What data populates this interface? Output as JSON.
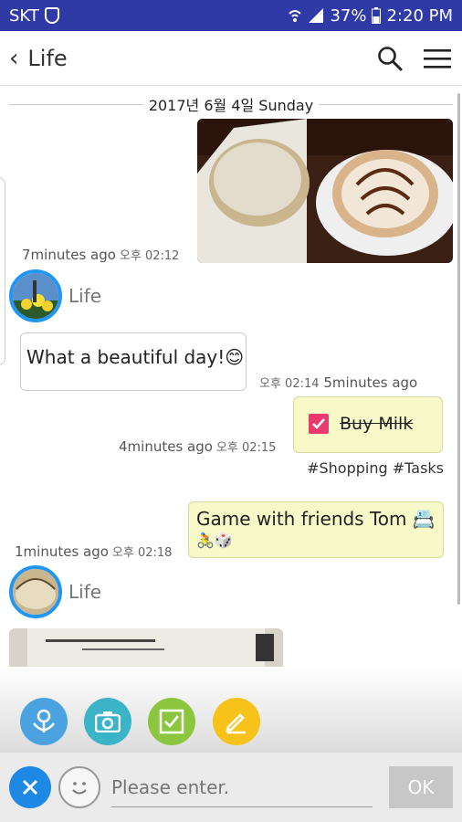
{
  "status_bar": {
    "carrier": "SKT",
    "battery": "37%",
    "time": "2:20 PM"
  },
  "header": {
    "title": "Life"
  },
  "chat": {
    "date": "2017년 6월 4일 Sunday",
    "messages": [
      {
        "type": "photo",
        "relative_time": "7minutes ago",
        "time": "오후 02:12"
      },
      {
        "type": "text",
        "sender": "Life",
        "text": "What a beautiful day!😊",
        "time": "오후 02:14",
        "relative_time": "5minutes ago"
      },
      {
        "type": "task",
        "text": "Buy Milk",
        "relative_time": "4minutes ago",
        "time": "오후 02:15",
        "tags": "#Shopping #Tasks"
      },
      {
        "type": "text",
        "text": "Game with friends Tom 📇",
        "text_line2": "🚴🎲",
        "relative_time": "1minutes ago",
        "time": "오후 02:18"
      },
      {
        "type": "photo",
        "sender": "Life"
      }
    ]
  },
  "input": {
    "placeholder": "Please enter.",
    "ok_label": "OK"
  },
  "colors": {
    "status_bar": "#2f3aa6",
    "task_check": "#e9396d",
    "action_flower": "#4aa3e0",
    "action_camera": "#3cb4c8",
    "action_check": "#8cc63f",
    "action_pencil": "#f7c21a",
    "close_button": "#1e88e5"
  }
}
